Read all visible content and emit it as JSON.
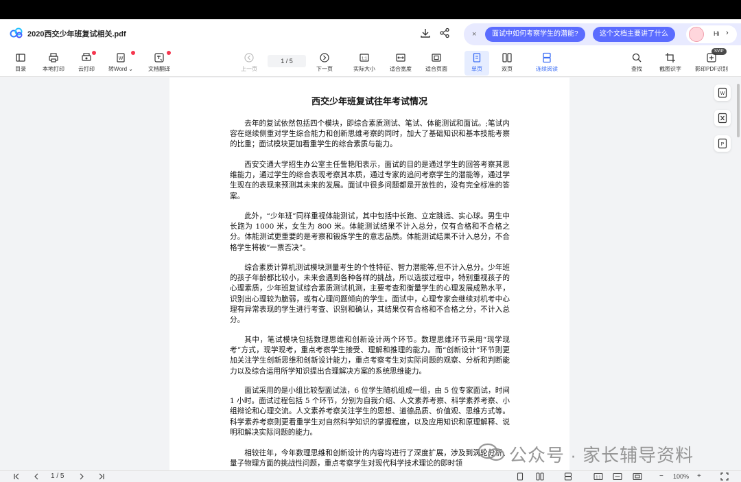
{
  "window": {
    "doc_title": "2020西交少年班复试相关.pdf"
  },
  "ai_bar": {
    "close_glyph": "×",
    "suggestion_1": "面试中如何考察学生的潜能?",
    "suggestion_2": "这个文档主要讲了什么",
    "hi_label": "Hi",
    "hi_chevron": "›"
  },
  "toolbar": {
    "catalog": "目录",
    "local_print": "本地打印",
    "cloud_print": "云打印",
    "to_word": "转Word ⌄",
    "doc_translate": "文档翻译",
    "prev_page": "上一页",
    "page_indicator": "1  /  5",
    "next_page": "下一页",
    "actual_size": "实际大小",
    "fit_width": "适合宽度",
    "fit_page": "适合页面",
    "single_page": "单页",
    "double_page": "双页",
    "continuous": "连续阅读",
    "find": "查找",
    "screenshot_ocr": "截图识字",
    "ocr_pdf": "影印PDF识别",
    "svip_badge": "SVIP"
  },
  "document": {
    "heading": "西交少年班复试往年考试情况",
    "paragraphs": [
      "去年的复试依然包括四个模块，即综合素质测试、笔试、体能测试和面试。;笔试内容在继续侧重对学生综合能力和创新思维考察的同时，加大了基础知识和基本技能考察的比重；面试模块更加看重学生的综合素质与能力。",
      "西安交通大学招生办公室主任訾艳阳表示，面试的目的是通过学生的回答考察其思维能力，通过学生的综合表现考察其本质，通过专家的追问考察学生的潜能等，通过学生现在的表现来预测其未来的发展。面试中很多问题都是开放性的，没有完全标准的答案。",
      "此外，“少年班”同样重视体能测试，其中包括中长跑、立定跳远、实心球。男生中长跑为 1000 米，女生为 800 米。体能测试结果不计入总分，仅有合格和不合格之分。体能测试更重要的是考察和锻炼学生的意志品质。体能测试结果不计入总分，不合格学生将被“一票否决”。",
      "综合素质计算机测试模块测量考生的个性特征、智力潜能等,但不计入总分。少年班的孩子年龄都比较小，未来会遇到各种各样的挑战，所以选拔过程中，特别重视孩子的心理素质，少年班复试综合素质测试机测，主要考查和衡量学生的心理发展成熟水平，识别出心理较为脆弱，或有心理问题倾向的学生。面试中，心理专家会继续对机考中心理有异常表现的学生进行考查、识别和确认，其结果仅有合格和不合格之分，不计入总分。",
      "其中，笔试模块包括数理思维和创新设计两个环节。数理思维环节采用“现学现考”方式，现学现考，重点考察学生接受、理解和推理的能力。而“创新设计”环节则更加关注学生创新思维和创新设计能力，重点考察考生对实际问题的观察、分析和判断能力以及综合运用所学知识提出合理解决方案的系统思维能力。",
      "面试采用的是小组比较型面试法，6 位学生随机组成一组，由 5 位专家面试，时间 1 小时。面试过程包括 5 个环节，分别为自我介绍、人文素养考察、科学素养考察、小组辩论和心理交流。人文素养考察关注学生的思想、道德品质、价值观、思维方式等。科学素养考察则更看重学生对自然科学知识的掌握程度，以及应用知识和原理解释、说明和解决实际问题的能力。",
      "相较往年，今年数理思维和创新设计的内容均进行了深度扩展，涉及到涡轮分析、量子物理方面的挑战性问题，重点考察学生对现代科学技术理论的即时领"
    ]
  },
  "watermark": {
    "text": "公众号 · 家长辅导资料"
  },
  "bottom_bar": {
    "page_indicator": "1 / 5",
    "zoom": "100%",
    "zoom_minus": "−",
    "zoom_plus": "+"
  },
  "colors": {
    "accent": "#3a6cf4",
    "ai_chip": "#5b6cff",
    "ai_bar_bg": "#e8eaff",
    "red_dot": "#f5364e"
  }
}
